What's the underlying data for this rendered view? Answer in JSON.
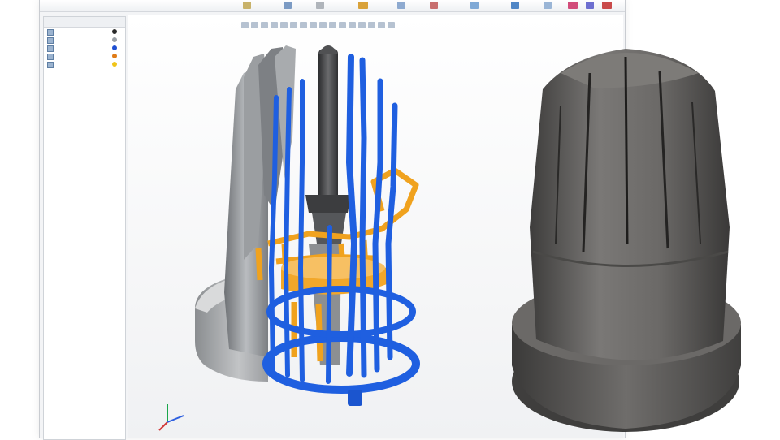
{
  "feature_tree": {
    "items": [
      {
        "swatch": "#2a2a2a"
      },
      {
        "swatch": "#9aa0a6"
      },
      {
        "swatch": "#1f4fd1"
      },
      {
        "swatch": "#e07b16"
      },
      {
        "swatch": "#f0c419"
      }
    ]
  },
  "colors": {
    "casting": "#8f9296",
    "cooling_channels": "#1f5fe0",
    "gating_system": "#f0a21e",
    "core": "#4a4b4d",
    "printed_part": "#5c5b59"
  },
  "icons": {
    "axis_triad": "axis-triad-icon"
  }
}
